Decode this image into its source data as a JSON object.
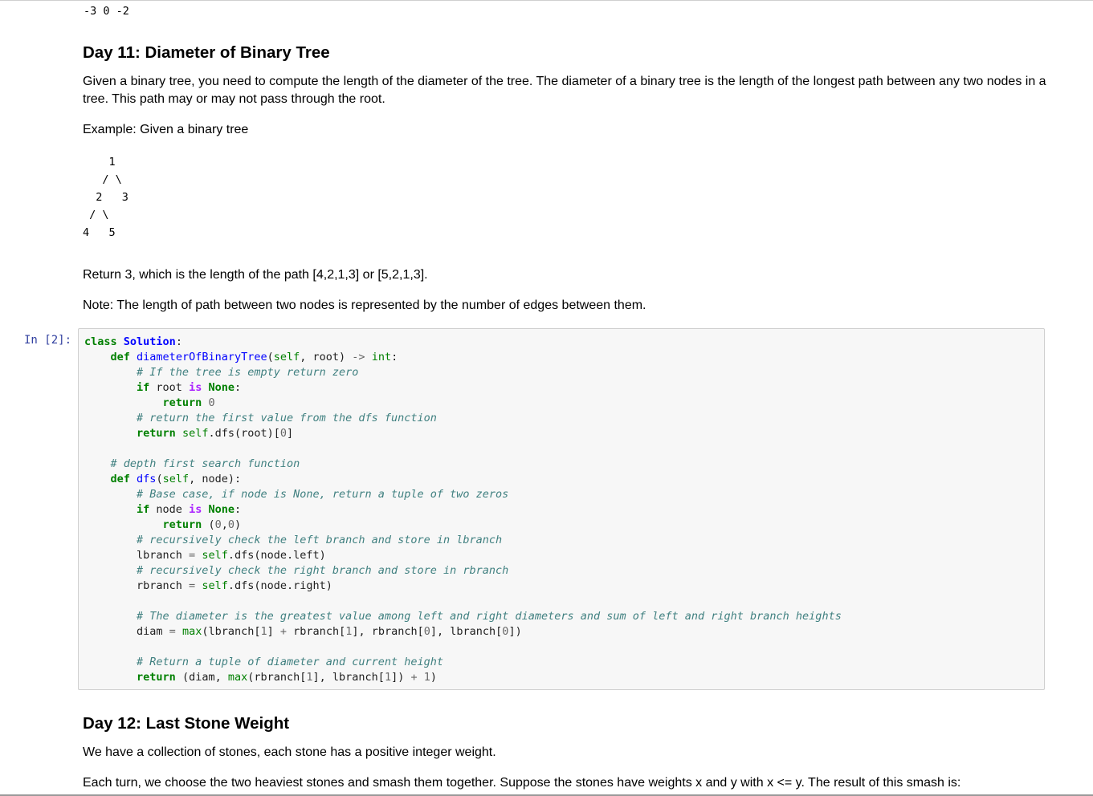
{
  "previous_output": "-3 0 -2",
  "day11": {
    "title": "Day 11: Diameter of Binary Tree",
    "description": "Given a binary tree, you need to compute the length of the diameter of the tree. The diameter of a binary tree is the length of the longest path between any two nodes in a tree. This path may or may not pass through the root.",
    "example_intro": "Example: Given a binary tree",
    "tree_lines": [
      "    1",
      "   / \\",
      "  2   3",
      " / \\",
      "4   5"
    ],
    "return_text": "Return 3, which is the length of the path [4,2,1,3] or [5,2,1,3].",
    "note": "Note: The length of path between two nodes is represented by the number of edges between them."
  },
  "cell": {
    "prompt": "In [2]:",
    "lines": [
      [
        [
          "kw",
          "class"
        ],
        [
          "t",
          " "
        ],
        [
          "cls",
          "Solution"
        ],
        [
          "t",
          ":"
        ]
      ],
      [
        [
          "t",
          "    "
        ],
        [
          "kw",
          "def"
        ],
        [
          "t",
          " "
        ],
        [
          "fn",
          "diameterOfBinaryTree"
        ],
        [
          "t",
          "("
        ],
        [
          "bi",
          "self"
        ],
        [
          "t",
          ", root) "
        ],
        [
          "op",
          "->"
        ],
        [
          "t",
          " "
        ],
        [
          "bi",
          "int"
        ],
        [
          "t",
          ":"
        ]
      ],
      [
        [
          "t",
          "        "
        ],
        [
          "cm",
          "# If the tree is empty return zero"
        ]
      ],
      [
        [
          "t",
          "        "
        ],
        [
          "kw",
          "if"
        ],
        [
          "t",
          " root "
        ],
        [
          "kw2",
          "is"
        ],
        [
          "t",
          " "
        ],
        [
          "kw",
          "None"
        ],
        [
          "t",
          ":"
        ]
      ],
      [
        [
          "t",
          "            "
        ],
        [
          "kw",
          "return"
        ],
        [
          "t",
          " "
        ],
        [
          "num",
          "0"
        ]
      ],
      [
        [
          "t",
          "        "
        ],
        [
          "cm",
          "# return the first value from the dfs function"
        ]
      ],
      [
        [
          "t",
          "        "
        ],
        [
          "kw",
          "return"
        ],
        [
          "t",
          " "
        ],
        [
          "bi",
          "self"
        ],
        [
          "t",
          ".dfs(root)["
        ],
        [
          "num",
          "0"
        ],
        [
          "t",
          "]"
        ]
      ],
      [
        [
          "t",
          ""
        ]
      ],
      [
        [
          "t",
          "    "
        ],
        [
          "cm",
          "# depth first search function"
        ]
      ],
      [
        [
          "t",
          "    "
        ],
        [
          "kw",
          "def"
        ],
        [
          "t",
          " "
        ],
        [
          "fn",
          "dfs"
        ],
        [
          "t",
          "("
        ],
        [
          "bi",
          "self"
        ],
        [
          "t",
          ", node):"
        ]
      ],
      [
        [
          "t",
          "        "
        ],
        [
          "cm",
          "# Base case, if node is None, return a tuple of two zeros"
        ]
      ],
      [
        [
          "t",
          "        "
        ],
        [
          "kw",
          "if"
        ],
        [
          "t",
          " node "
        ],
        [
          "kw2",
          "is"
        ],
        [
          "t",
          " "
        ],
        [
          "kw",
          "None"
        ],
        [
          "t",
          ":"
        ]
      ],
      [
        [
          "t",
          "            "
        ],
        [
          "kw",
          "return"
        ],
        [
          "t",
          " ("
        ],
        [
          "num",
          "0"
        ],
        [
          "t",
          ","
        ],
        [
          "num",
          "0"
        ],
        [
          "t",
          ")"
        ]
      ],
      [
        [
          "t",
          "        "
        ],
        [
          "cm",
          "# recursively check the left branch and store in lbranch"
        ]
      ],
      [
        [
          "t",
          "        lbranch "
        ],
        [
          "op",
          "="
        ],
        [
          "t",
          " "
        ],
        [
          "bi",
          "self"
        ],
        [
          "t",
          ".dfs(node.left)"
        ]
      ],
      [
        [
          "t",
          "        "
        ],
        [
          "cm",
          "# recursively check the right branch and store in rbranch"
        ]
      ],
      [
        [
          "t",
          "        rbranch "
        ],
        [
          "op",
          "="
        ],
        [
          "t",
          " "
        ],
        [
          "bi",
          "self"
        ],
        [
          "t",
          ".dfs(node.right)"
        ]
      ],
      [
        [
          "t",
          ""
        ]
      ],
      [
        [
          "t",
          "        "
        ],
        [
          "cm",
          "# The diameter is the greatest value among left and right diameters and sum of left and right branch heights"
        ]
      ],
      [
        [
          "t",
          "        diam "
        ],
        [
          "op",
          "="
        ],
        [
          "t",
          " "
        ],
        [
          "bi",
          "max"
        ],
        [
          "t",
          "(lbranch["
        ],
        [
          "num",
          "1"
        ],
        [
          "t",
          "] "
        ],
        [
          "op",
          "+"
        ],
        [
          "t",
          " rbranch["
        ],
        [
          "num",
          "1"
        ],
        [
          "t",
          "], rbranch["
        ],
        [
          "num",
          "0"
        ],
        [
          "t",
          "], lbranch["
        ],
        [
          "num",
          "0"
        ],
        [
          "t",
          "])"
        ]
      ],
      [
        [
          "t",
          ""
        ]
      ],
      [
        [
          "t",
          "        "
        ],
        [
          "cm",
          "# Return a tuple of diameter and current height"
        ]
      ],
      [
        [
          "t",
          "        "
        ],
        [
          "kw",
          "return"
        ],
        [
          "t",
          " (diam, "
        ],
        [
          "bi",
          "max"
        ],
        [
          "t",
          "(rbranch["
        ],
        [
          "num",
          "1"
        ],
        [
          "t",
          "], lbranch["
        ],
        [
          "num",
          "1"
        ],
        [
          "t",
          "]) "
        ],
        [
          "op",
          "+"
        ],
        [
          "t",
          " "
        ],
        [
          "num",
          "1"
        ],
        [
          "t",
          ")"
        ]
      ]
    ]
  },
  "day12": {
    "title": "Day 12: Last Stone Weight",
    "description": "We have a collection of stones, each stone has a positive integer weight.",
    "turn_text": "Each turn, we choose the two heaviest stones and smash them together. Suppose the stones have weights x and y with x <= y. The result of this smash is:"
  }
}
